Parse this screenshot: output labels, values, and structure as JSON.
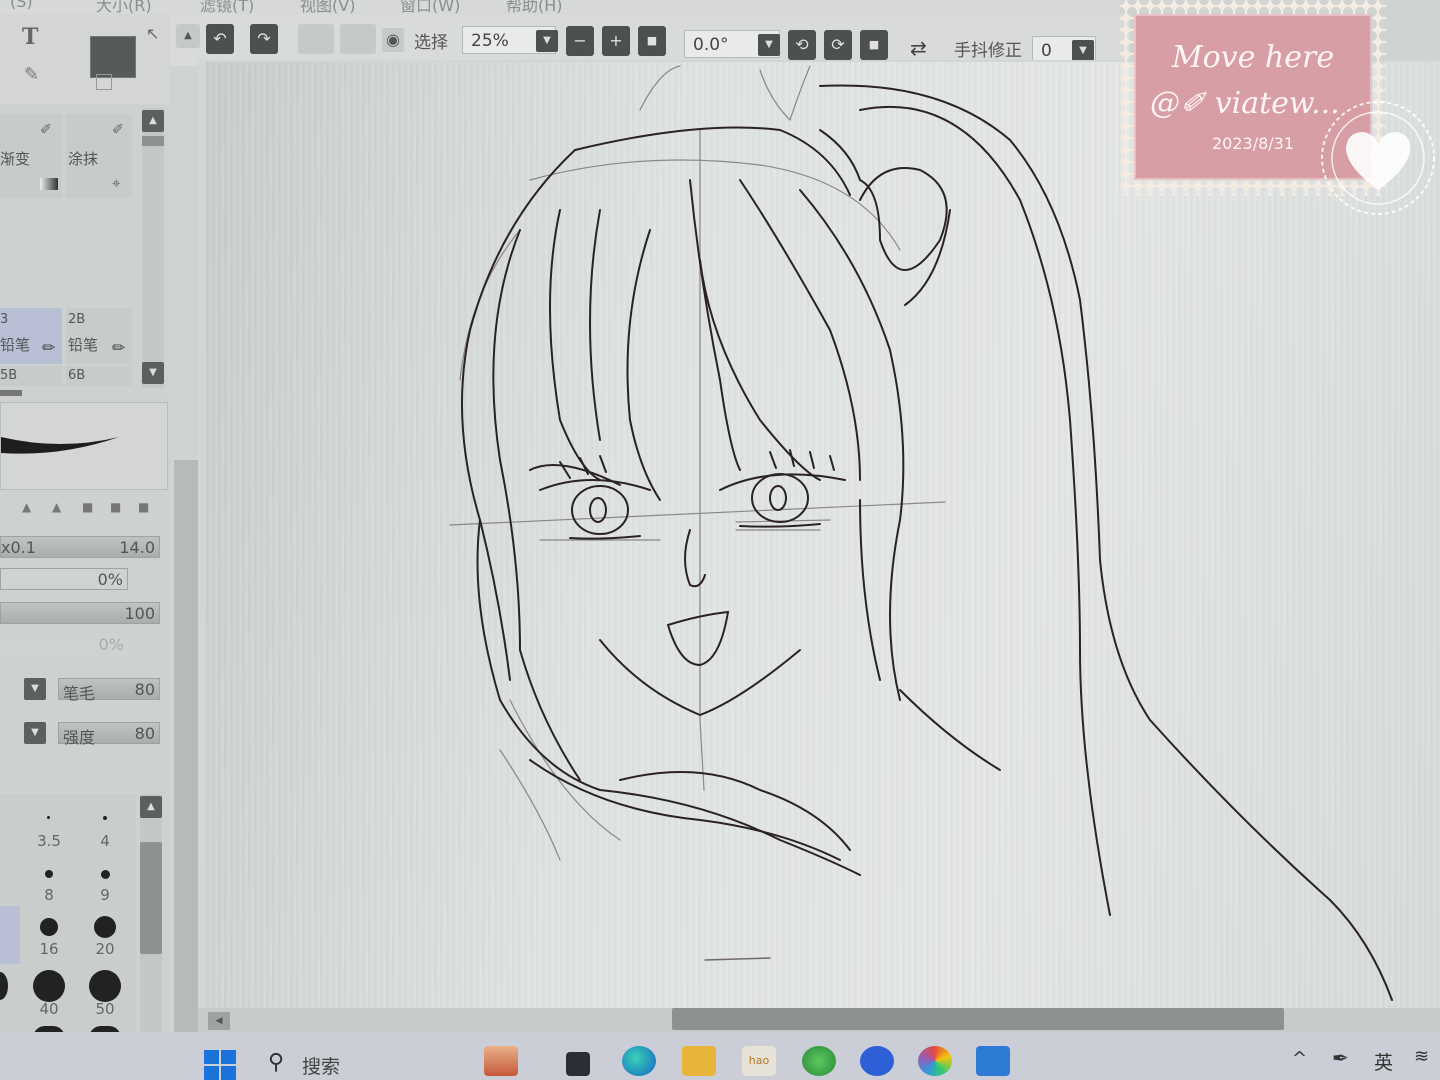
{
  "menubar": {
    "items": [
      "(S)",
      "大小(R)",
      "滤镜(T)",
      "视图(V)",
      "窗口(W)",
      "帮助(H)"
    ]
  },
  "toolbar": {
    "select_label": "选择",
    "zoom": "25%",
    "rotation": "0.0°",
    "stabilizer_label": "手抖修正",
    "stabilizer_value": "0"
  },
  "tools": {
    "text_tool_glyph": "T"
  },
  "brush_panel": {
    "row1": [
      "渐变",
      "涂抹"
    ],
    "row2_left": {
      "size": "3",
      "name": "铅笔"
    },
    "row2_right": {
      "size": "2B",
      "name": "铅笔"
    },
    "row3": [
      "5B",
      "6B"
    ]
  },
  "settings": {
    "size_multiplier": "x0.1",
    "size_value": "14.0",
    "min_size": "0%",
    "density": "100",
    "min_density": "0%",
    "brush_label": "笔毛",
    "brush_value": "80",
    "strength_label": "强度",
    "strength_value": "80"
  },
  "brush_sizes": [
    {
      "label": "3.5"
    },
    {
      "label": "4"
    },
    {
      "label": "8"
    },
    {
      "label": "9"
    },
    {
      "label": "16"
    },
    {
      "label": "20"
    },
    {
      "label": "40"
    },
    {
      "label": "50"
    }
  ],
  "taskbar": {
    "search": "搜索",
    "ime": "英"
  },
  "stamp": {
    "title": "Move here",
    "handle": "@✐ viatew...",
    "date": "2023/8/31"
  }
}
